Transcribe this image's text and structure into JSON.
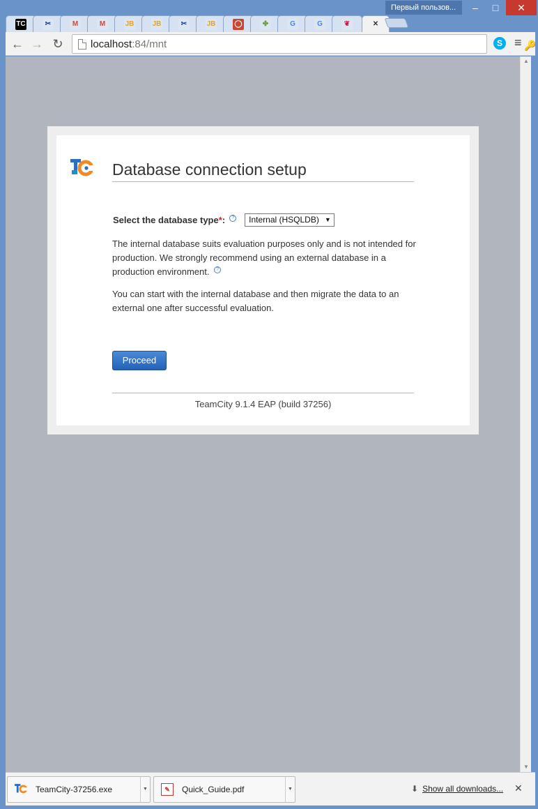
{
  "window": {
    "user_badge": "Первый пользов...",
    "minimize": "–",
    "maximize": "□",
    "close": "✕"
  },
  "tabs": [
    {
      "icon": "teamcity-favicon",
      "glyph": "TC",
      "color": "#000000",
      "fg": "#ffffff"
    },
    {
      "icon": "tools-favicon",
      "glyph": "✂",
      "color": "#dce6f3",
      "fg": "#1a3d7c"
    },
    {
      "icon": "gmail-favicon",
      "glyph": "M",
      "color": "#dce6f3",
      "fg": "#d14836"
    },
    {
      "icon": "gmail-favicon",
      "glyph": "M",
      "color": "#dce6f3",
      "fg": "#d14836"
    },
    {
      "icon": "jetbrains-favicon",
      "glyph": "JB",
      "color": "#dce6f3",
      "fg": "#e0a32e"
    },
    {
      "icon": "jetbrains-favicon",
      "glyph": "JB",
      "color": "#dce6f3",
      "fg": "#e0a32e"
    },
    {
      "icon": "tools-favicon",
      "glyph": "✂",
      "color": "#dce6f3",
      "fg": "#1a3d7c"
    },
    {
      "icon": "jetbrains-favicon",
      "glyph": "JB",
      "color": "#dce6f3",
      "fg": "#e0a32e"
    },
    {
      "icon": "oracle-favicon",
      "glyph": "◯",
      "color": "#c74634",
      "fg": "#ffffff"
    },
    {
      "icon": "puzzle-favicon",
      "glyph": "✤",
      "color": "#dce6f3",
      "fg": "#6a9a3c"
    },
    {
      "icon": "google-favicon",
      "glyph": "G",
      "color": "#dce6f3",
      "fg": "#4285f4"
    },
    {
      "icon": "google-favicon",
      "glyph": "G",
      "color": "#dce6f3",
      "fg": "#4285f4"
    },
    {
      "icon": "raspberry-favicon",
      "glyph": "❦",
      "color": "#dce6f3",
      "fg": "#c51a4a"
    },
    {
      "icon": "close-icon",
      "glyph": "✕",
      "color": "#f2f2f2",
      "fg": "#333333",
      "active": true
    }
  ],
  "toolbar": {
    "back": "←",
    "forward": "→",
    "reload": "↻",
    "url_host": "localhost",
    "url_path": ":84/mnt",
    "key_icon": "🔑",
    "star_icon": "☆",
    "skype_icon": "S",
    "menu_icon": "≡"
  },
  "page": {
    "title": "Database connection setup",
    "db_label": "Select the database type",
    "db_required": "*",
    "db_colon": ":",
    "db_selected": "Internal (HSQLDB)",
    "help_glyph": "?",
    "paragraph1": "The internal database suits evaluation purposes only and is not intended for production. We strongly recommend using an external database in a production environment.",
    "paragraph2": "You can start with the internal database and then migrate the data to an external one after successful evaluation.",
    "proceed_label": "Proceed",
    "footer": "TeamCity 9.1.4 EAP (build 37256)"
  },
  "downloads": {
    "items": [
      {
        "name": "TeamCity-37256.exe",
        "icon": "teamcity-file-icon"
      },
      {
        "name": "Quick_Guide.pdf",
        "icon": "pdf-file-icon"
      }
    ],
    "show_all": "Show all downloads...",
    "close": "✕"
  },
  "colors": {
    "accent": "#2a6ac0",
    "frame": "#6a93c9",
    "page_bg": "#b1b6be",
    "required": "#d9222a"
  }
}
